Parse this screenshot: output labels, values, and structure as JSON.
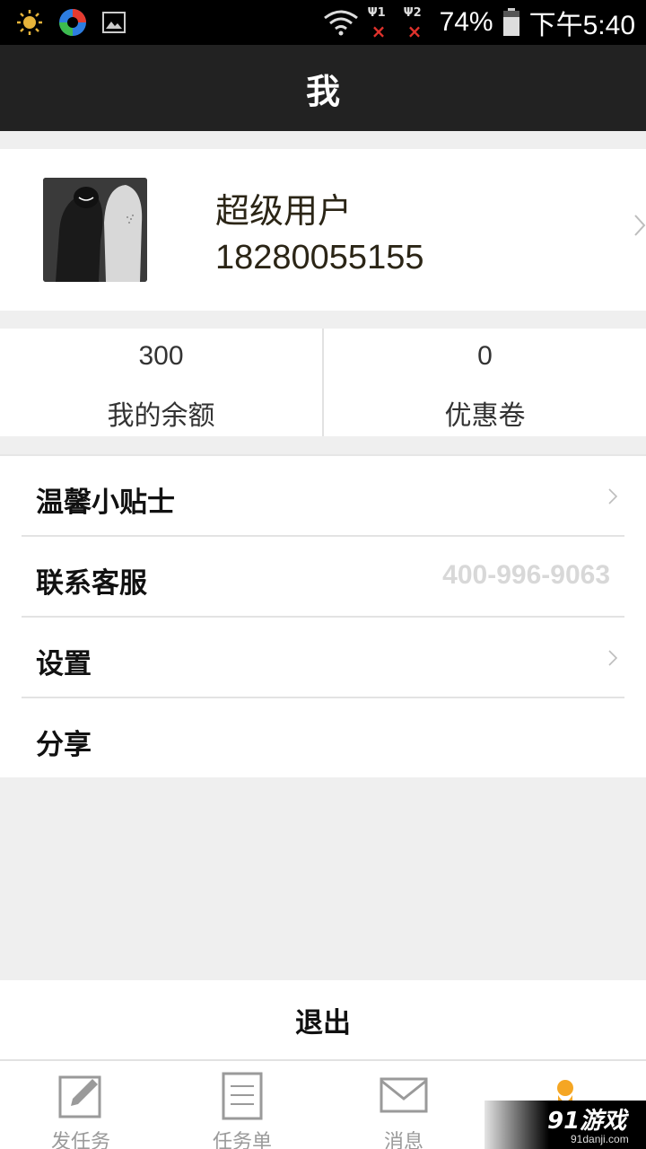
{
  "status_bar": {
    "battery": "74%",
    "time": "下午5:40",
    "sim1_label": "Ψ1",
    "sim2_label": "Ψ2",
    "sim_x": "×"
  },
  "header": {
    "title": "我"
  },
  "profile": {
    "name": "超级用户",
    "phone": "18280055155"
  },
  "stats": [
    {
      "value": "300",
      "label": "我的余额"
    },
    {
      "value": "0",
      "label": "优惠卷"
    }
  ],
  "menu": [
    {
      "label": "温馨小贴士",
      "icon": "chevron-right-icon"
    },
    {
      "label": "联系客服",
      "value": "400-996-9063"
    },
    {
      "label": "设置",
      "icon": "chevron-right-icon"
    },
    {
      "label": "分享"
    }
  ],
  "logout_label": "退出",
  "tabs": [
    {
      "label": "发任务",
      "icon": "edit-icon"
    },
    {
      "label": "任务单",
      "icon": "document-icon"
    },
    {
      "label": "消息",
      "icon": "mail-icon"
    },
    {
      "label": "",
      "icon": "person-icon",
      "active": true
    }
  ],
  "watermark": {
    "logo": "91游戏",
    "site": "91danji.com"
  },
  "colors": {
    "title_bar": "#222222",
    "active_tab": "#f5a623",
    "divider": "#e3e3e3"
  }
}
